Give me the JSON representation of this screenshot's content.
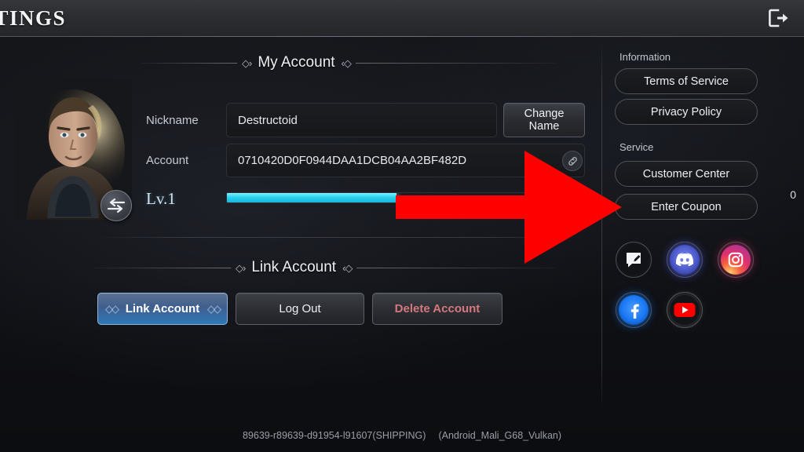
{
  "topbar": {
    "title": "TTINGS",
    "exit_icon": "exit-door-arrow-icon"
  },
  "main": {
    "sections": [
      {
        "id": "my-account",
        "title": "My Account"
      },
      {
        "id": "link-account",
        "title": "Link Account"
      }
    ],
    "avatar": {
      "name": "character-portrait",
      "swap_icon": "swap-arrows-icon"
    },
    "fields": [
      {
        "label": "Nickname",
        "value": "Destructoid",
        "placeholder": "Destructoid"
      },
      {
        "label": "Account",
        "value": "0710420D0F0944DAA1DCB04AA2BF482D",
        "placeholder": "0710420D0F0944DAA1DCB04AA2BF482D",
        "action_icon": "copy-link-icon"
      }
    ],
    "change_name_button": "Change\nName",
    "change_name_line1": "Change",
    "change_name_line2": "Name",
    "level": {
      "label": "Lv.1",
      "progress_percent": 48,
      "value_text": "0"
    },
    "link_buttons": [
      {
        "label": "Link Account",
        "style": "primary"
      },
      {
        "label": "Log Out",
        "style": "default"
      },
      {
        "label": "Delete Account",
        "style": "danger"
      }
    ]
  },
  "sidebar": {
    "groups": [
      {
        "heading": "Information",
        "items": [
          {
            "label": "Terms of Service"
          },
          {
            "label": "Privacy Policy"
          }
        ]
      },
      {
        "heading": "Service",
        "items": [
          {
            "label": "Customer Center"
          },
          {
            "label": "Enter Coupon"
          }
        ]
      }
    ],
    "social": [
      {
        "name": "forum-write-icon",
        "label": "Forum"
      },
      {
        "name": "discord-icon",
        "label": "Discord"
      },
      {
        "name": "instagram-icon",
        "label": "Instagram"
      },
      {
        "name": "facebook-icon",
        "label": "Facebook"
      },
      {
        "name": "youtube-icon",
        "label": "YouTube"
      }
    ]
  },
  "footer": {
    "build": "89639-r89639-d91954-l91607(SHIPPING)",
    "platform": "(Android_Mali_G68_Vulkan)"
  },
  "annotation": {
    "arrow_color": "#FF0000",
    "points_to": "Enter Coupon"
  },
  "colors": {
    "accent_blue": "#2f78b8",
    "xp_cyan": "#2ad2f0",
    "danger_red": "#d4787e",
    "arrow_red": "#FF0000",
    "panel_bg": "#15171b"
  }
}
